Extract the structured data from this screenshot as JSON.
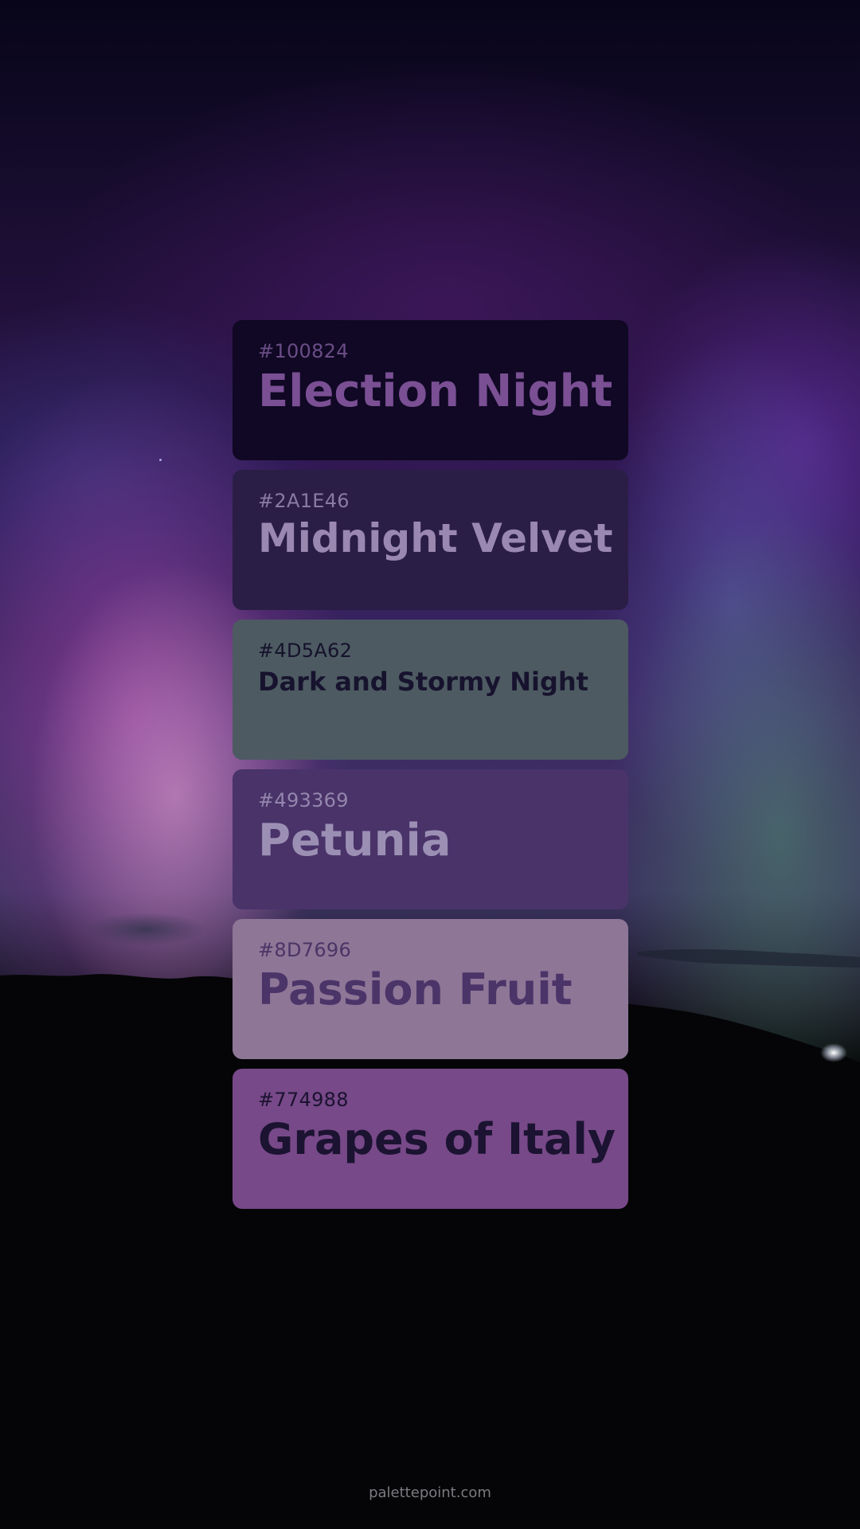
{
  "swatches": [
    {
      "hex": "#100824",
      "name": "Election Night",
      "bg": "#100824",
      "hex_color": "#6a4d86",
      "name_color": "#7a4f94"
    },
    {
      "hex": "#2A1E46",
      "name": "Midnight Velvet",
      "bg": "#2a1e46",
      "hex_color": "#8a7aa3",
      "name_color": "#9a88b0"
    },
    {
      "hex": "#4D5A62",
      "name": "Dark and Stormy Night",
      "bg": "#4d5a62",
      "hex_color": "#14122a",
      "name_color": "#17132e"
    },
    {
      "hex": "#493369",
      "name": "Petunia",
      "bg": "#493369",
      "hex_color": "#9486ad",
      "name_color": "#9c8fb4"
    },
    {
      "hex": "#8D7696",
      "name": "Passion Fruit",
      "bg": "#8d7696",
      "hex_color": "#4a3566",
      "name_color": "#4b3468"
    },
    {
      "hex": "#774988",
      "name": "Grapes of Italy",
      "bg": "#774988",
      "hex_color": "#1a1230",
      "name_color": "#1b1331"
    }
  ],
  "footer": {
    "text": "palettepoint.com"
  }
}
